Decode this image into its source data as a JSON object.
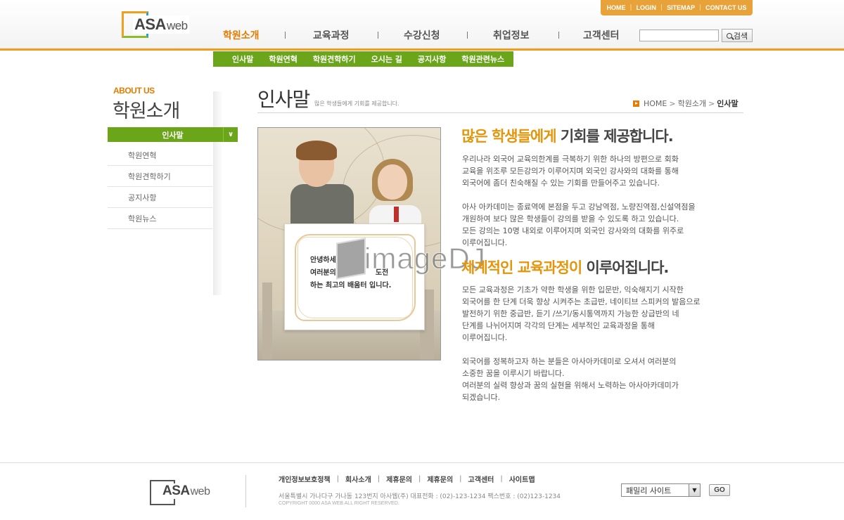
{
  "brand": {
    "logo_main": "ASA",
    "logo_sub": "web"
  },
  "util_links": [
    "HOME",
    "LOGIN",
    "SITEMAP",
    "CONTACT US"
  ],
  "gnb": {
    "items": [
      "학원소개",
      "교육과정",
      "수강신청",
      "취업정보",
      "고객센터"
    ],
    "active_index": 0
  },
  "search": {
    "value": "",
    "button_label": "검색"
  },
  "subnav": [
    "인사말",
    "학원연혁",
    "학원견학하기",
    "오시는 길",
    "공지사항",
    "학원관련뉴스"
  ],
  "sidebar": {
    "heading_en": "ABOUT US",
    "heading_ko": "학원소개",
    "active_label": "인사말",
    "items": [
      "학원연혁",
      "학원견학하기",
      "공지사항",
      "학원뉴스"
    ]
  },
  "page": {
    "title": "인사말",
    "description": "많은 학생들에게 기회를 제공합니다.",
    "breadcrumb": [
      "HOME",
      "학원소개",
      "인사말"
    ]
  },
  "photo_card": {
    "lines": [
      "안녕하세",
      "여러분의",
      "하는 최고의 배움터 입니다."
    ],
    "hidden_fragment": "도전"
  },
  "watermark": "imageDJ",
  "section1": {
    "title_highlight": "많은 학생들에게",
    "title_rest": " 기회를 제공합니다.",
    "paragraphs": [
      "우리나라 외국어 교육의한계를 극복하기 위한 하나의 방편으로 회화\n교육을 위조루 모든강의가 이루어지며 외국인 강사와의 대화를 통해\n외국어에 좀더 친숙해질 수 있는 기회를 만들어주고 있습니다.",
      "아사 아카데미는 종료역에 본점을 두고 강남역점, 노량진역점,신설역점을\n개원하여 보다 많은 학생들이 강의를 받을 수 있도록 하고 있습니다.\n모든 강의는 10명 내외로 이루어지며 외국인 강사와의 대화를 위주로\n이루어집니다."
    ]
  },
  "section2": {
    "title_highlight": "체계적인 교육과정이",
    "title_rest": " 이루어집니다.",
    "paragraphs": [
      "모든 교육과정은 기초가 약한 학생을 위한 입문반, 익숙해지기 시작한\n외국어를 한 단계 더욱 향상 시켜주는 초급반, 네이티브 스피커의 발음으로\n발전하기 위한 중급반, 듣기 /쓰기/동시통역까지 가능한 상급반의 네\n단계를 나뉘어지며 각각의 단계는 세부적인 교육과정을 통해\n이루어집니다.",
      "외국어를 정복하고자 하는 분들은 아사아카데미로 오셔서 여러분의\n소중한 꿈을 이루시기 바랍니다.\n여러분의 실력 향상과 꿈의 실현을 위해서 노력하는 아사아카데미가\n되겠습니다."
    ]
  },
  "footer": {
    "links": [
      "개인정보보호정책",
      "회사소개",
      "제휴문의",
      "제휴문의",
      "고객센터",
      "사이트맵"
    ],
    "address": "서울특별시 가나다구 가나동 123번지  아사웹(주) 대표전화 : (02)-123-1234 팩스번호 : (02)123-1234",
    "copyright": "COPYRIGHT 0000 ASA WEB  ALL RIGHT RESERVED.",
    "family_site": "패밀리 사이트",
    "go_label": "GO"
  },
  "colors": {
    "accent_orange": "#e57c00",
    "accent_green": "#6aa51a",
    "util_bar": "#e8a23a"
  }
}
